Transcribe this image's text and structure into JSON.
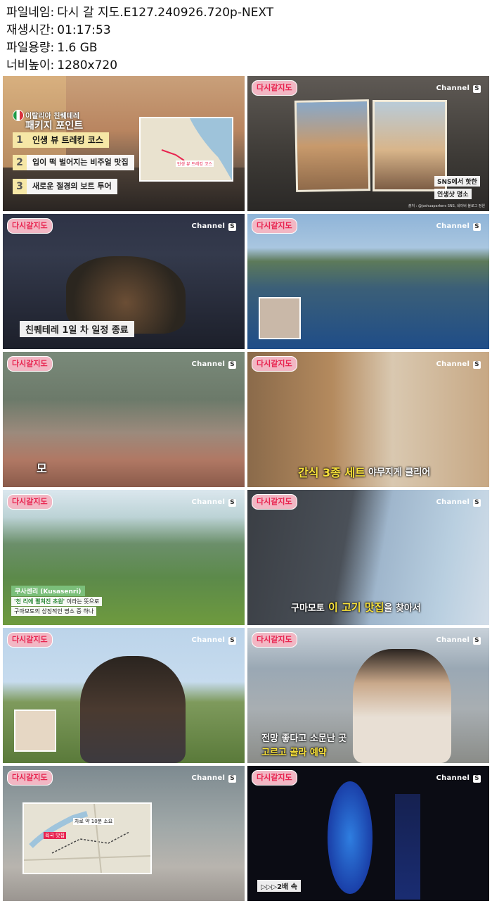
{
  "info": [
    {
      "label": "파일네임:",
      "value": "다시 갈 지도.E127.240926.720p-NEXT"
    },
    {
      "label": "재생시간:",
      "value": "01:17:53"
    },
    {
      "label": "파일용량:",
      "value": "1.6 GB"
    },
    {
      "label": "너비높이:",
      "value": "1280x720"
    }
  ],
  "show": {
    "logo": "다시갈지도",
    "channel": "Channel",
    "channel_s": "S"
  },
  "tiles": [
    {
      "topic": "이탈리아 친퀘테레",
      "heading": "패키지 포인트",
      "points": [
        {
          "num": "1",
          "text": "인생 뷰 트레킹 코스"
        },
        {
          "num": "2",
          "text": "입이 떡 벌어지는 비주얼 맛집"
        },
        {
          "num": "3",
          "text": "새로운 절경의 보트 투어"
        }
      ],
      "map_label": "인생 뷰 트레킹 코스"
    },
    {
      "tag1": "SNS에서 핫한",
      "tag2": "인생샷 명소",
      "credit": "출처 : @joshuaparkers SNS, 네이버 블로그 정원"
    },
    {
      "caption": "친퀘테레 1일 차 일정 종료"
    },
    {},
    {
      "caption": "모"
    },
    {
      "caption_a": "간식 3종 세트",
      "caption_b": "야무지게 클리어"
    },
    {
      "place": "쿠사센리",
      "place_en": "Kusasenri",
      "desc_a": "'천 리에 펼쳐진 초원'",
      "desc_b": "이라는 뜻으로",
      "desc_c": "구마모토의 상징적인 명소 중 하나"
    },
    {
      "caption_a": "구마모토",
      "caption_b": "이 고기 맛집",
      "caption_c": "을 찾아서"
    },
    {},
    {
      "caption_a": "전망 좋다고 소문난 곳",
      "caption_b": "고르고 골라 예약"
    },
    {
      "map_label_a": "차로 약 10분 소요",
      "map_label_b": "육국 맛집"
    },
    {
      "caption": "▷▷▷2배 속"
    }
  ]
}
